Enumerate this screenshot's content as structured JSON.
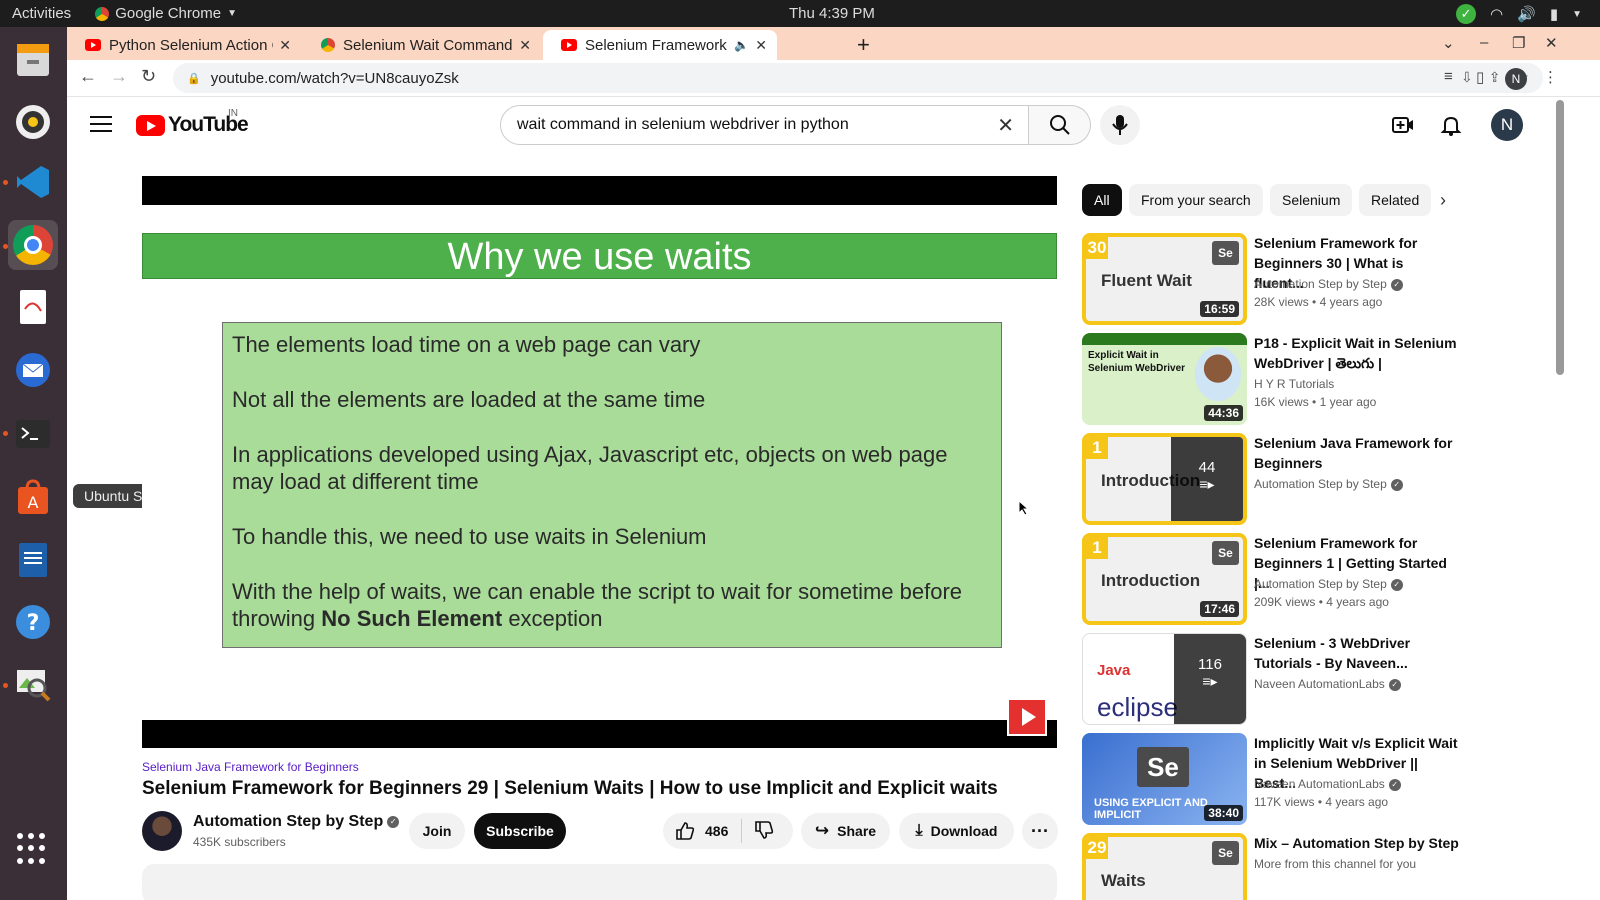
{
  "os": {
    "activities": "Activities",
    "app_name": "Google Chrome",
    "clock": "Thu  4:39 PM",
    "dock_tooltip": "Ubuntu Software"
  },
  "browser": {
    "tabs": [
      {
        "title": "Python Selenium Action C",
        "icon": "youtube-icon"
      },
      {
        "title": "Selenium Wait Command",
        "icon": "chrome-icon"
      },
      {
        "title": "Selenium Framework f",
        "icon": "youtube-icon",
        "active": true
      }
    ],
    "url": "youtube.com/watch?v=UN8cauyoZsk",
    "profile_initial": "N"
  },
  "youtube": {
    "logo_text": "YouTube",
    "country_code": "IN",
    "search_query": "wait command in selenium webdriver in python",
    "avatar_initial": "N"
  },
  "slide": {
    "title": "Why we use waits",
    "lines": [
      "The elements load time on a web page can vary",
      "Not all the elements are loaded at the same time",
      "In applications developed using Ajax, Javascript etc, objects on web page may load at different time",
      "To handle this, we need to use waits in Selenium"
    ],
    "last_line_pre": "With the help of waits, we can enable the script to wait for sometime before throwing ",
    "last_line_bold": "No Such Element",
    "last_line_post": " exception"
  },
  "video": {
    "playlist": "Selenium Java Framework for Beginners",
    "title": "Selenium Framework for Beginners 29 | Selenium Waits | How to use Implicit and Explicit waits",
    "channel": "Automation Step by Step",
    "subscribers": "435K subscribers",
    "join": "Join",
    "subscribe": "Subscribe",
    "likes": "486",
    "share": "Share",
    "download": "Download"
  },
  "chips": [
    "All",
    "From your search",
    "Selenium",
    "Related"
  ],
  "related": [
    {
      "title": "Selenium Framework for Beginners 30 | What is fluent...",
      "channel": "Automation Step by Step",
      "views": "28K views",
      "age": "4 years ago",
      "duration": "16:59",
      "thumb_num": "30",
      "thumb_text": "Fluent Wait"
    },
    {
      "title": "P18 - Explicit Wait in Selenium WebDriver | తెలుగు |",
      "channel": "H Y R Tutorials",
      "views": "16K views",
      "age": "1 year ago",
      "duration": "44:36",
      "thumb_text": "Explicit Wait in Selenium WebDriver"
    },
    {
      "title": "Selenium Java Framework for Beginners",
      "channel": "Automation Step by Step",
      "playlist_count": "44",
      "thumb_num": "1",
      "thumb_text": "Introduction"
    },
    {
      "title": "Selenium Framework for Beginners 1 | Getting Started |...",
      "channel": "Automation Step by Step",
      "views": "209K views",
      "age": "4 years ago",
      "duration": "17:46",
      "thumb_num": "1",
      "thumb_text": "Introduction"
    },
    {
      "title": "Selenium - 3 WebDriver Tutorials - By Naveen...",
      "channel": "Naveen AutomationLabs",
      "playlist_count": "116",
      "thumb_text": "eclipse"
    },
    {
      "title": "Implicitly Wait v/s Explicit Wait in Selenium WebDriver || Best...",
      "channel": "Naveen AutomationLabs",
      "views": "117K views",
      "age": "4 years ago",
      "duration": "38:40",
      "thumb_text": "USING EXPLICIT AND IMPLICIT"
    },
    {
      "title": "Mix – Automation Step by Step",
      "channel": "More from this channel for you",
      "thumb_num": "29",
      "thumb_text": "Waits"
    }
  ]
}
